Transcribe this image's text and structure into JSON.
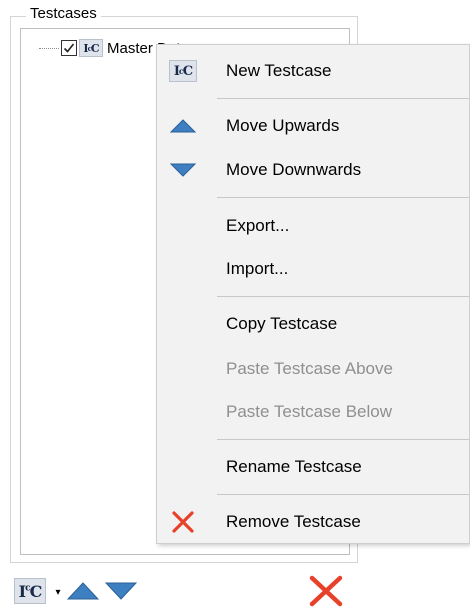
{
  "group": {
    "title": "Testcases"
  },
  "tree": {
    "node": {
      "label": "Master Data",
      "checked": true,
      "icon": "testcase-icon"
    }
  },
  "testcase_icon_text": "IC",
  "context_menu": {
    "items": [
      {
        "label": "New Testcase",
        "icon": "testcase-icon",
        "enabled": true
      },
      {
        "label": "Move Upwards",
        "icon": "triangle-up-icon",
        "enabled": true
      },
      {
        "label": "Move Downwards",
        "icon": "triangle-down-icon",
        "enabled": true
      },
      {
        "label": "Export...",
        "icon": "",
        "enabled": true
      },
      {
        "label": "Import...",
        "icon": "",
        "enabled": true
      },
      {
        "label": "Copy Testcase",
        "icon": "",
        "enabled": true
      },
      {
        "label": "Paste Testcase Above",
        "icon": "",
        "enabled": false
      },
      {
        "label": "Paste Testcase Below",
        "icon": "",
        "enabled": false
      },
      {
        "label": "Rename Testcase",
        "icon": "",
        "enabled": true
      },
      {
        "label": "Remove Testcase",
        "icon": "remove-x-icon",
        "enabled": true
      }
    ]
  },
  "toolbar": {
    "dropdown_glyph": "▾",
    "buttons": [
      "new-testcase",
      "move-up",
      "move-down",
      "remove"
    ]
  },
  "colors": {
    "arrow_fill": "#3d7fc0",
    "remove_red": "#e8412a",
    "menu_bg": "#f2f2f2",
    "disabled_text": "#8f8f8f"
  }
}
